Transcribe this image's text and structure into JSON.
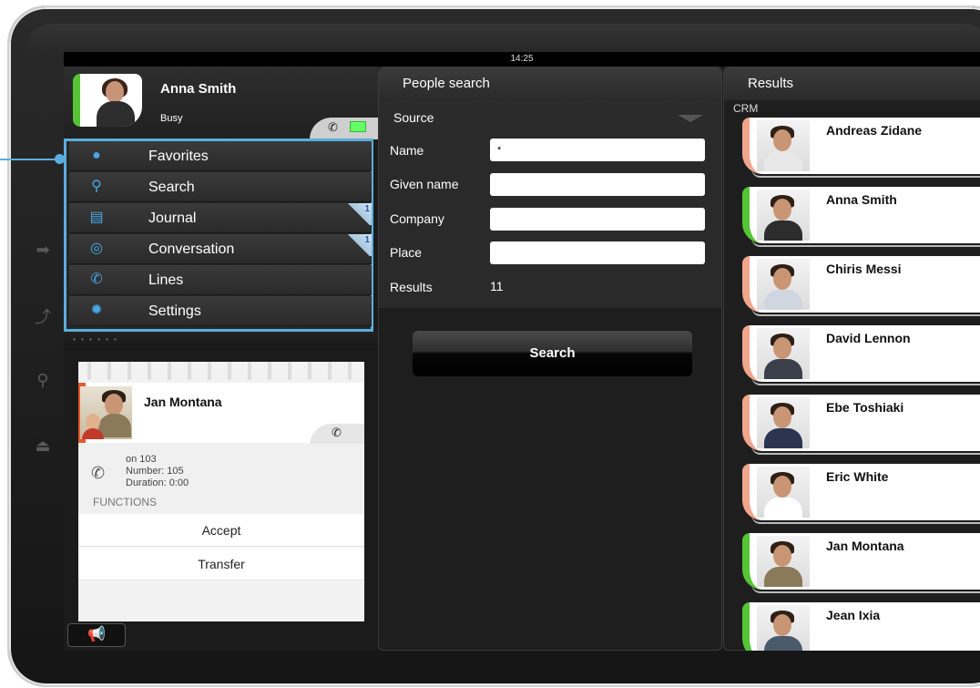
{
  "status_bar": {
    "time": "14:25"
  },
  "user": {
    "name": "Anna Smith",
    "status": "Busy"
  },
  "menu": {
    "items": [
      {
        "label": "Favorites",
        "icon": "person-icon"
      },
      {
        "label": "Search",
        "icon": "magnifier-icon"
      },
      {
        "label": "Journal",
        "icon": "notebook-icon",
        "badge": "1"
      },
      {
        "label": "Conversation",
        "icon": "speech-bubble-icon",
        "badge": "1"
      },
      {
        "label": "Lines",
        "icon": "phone-line-icon"
      },
      {
        "label": "Settings",
        "icon": "gear-icon"
      }
    ]
  },
  "call": {
    "name": "Jan Montana",
    "on_line": "on 103",
    "number": "Number: 105",
    "duration": "Duration: 0:00",
    "functions_label": "FUNCTIONS",
    "accept_label": "Accept",
    "transfer_label": "Transfer"
  },
  "people_search": {
    "title": "People search",
    "source_label": "Source",
    "fields": {
      "name_label": "Name",
      "name_value": "*",
      "given_name_label": "Given name",
      "given_name_value": "",
      "company_label": "Company",
      "company_value": "",
      "place_label": "Place",
      "place_value": "",
      "results_label": "Results",
      "results_value": "11"
    },
    "search_button": "Search"
  },
  "results": {
    "title": "Results",
    "group_label": "CRM",
    "items": [
      {
        "name": "Andreas Zidane",
        "status_color": "#f0a68c"
      },
      {
        "name": "Anna Smith",
        "status_color": "#55c535"
      },
      {
        "name": "Chiris Messi",
        "status_color": "#f0a68c"
      },
      {
        "name": "David Lennon",
        "status_color": "#f0a68c"
      },
      {
        "name": "Ebe Toshiaki",
        "status_color": "#f0a68c"
      },
      {
        "name": "Eric White",
        "status_color": "#f0a68c"
      },
      {
        "name": "Jan Montana",
        "status_color": "#55c535"
      },
      {
        "name": "Jean Ixia",
        "status_color": "#55c535"
      }
    ]
  },
  "colors": {
    "accent": "#5aaedb",
    "menu_icon": "#49a6e6",
    "busy_green": "#55c535",
    "call_orange": "#e55b2d"
  }
}
